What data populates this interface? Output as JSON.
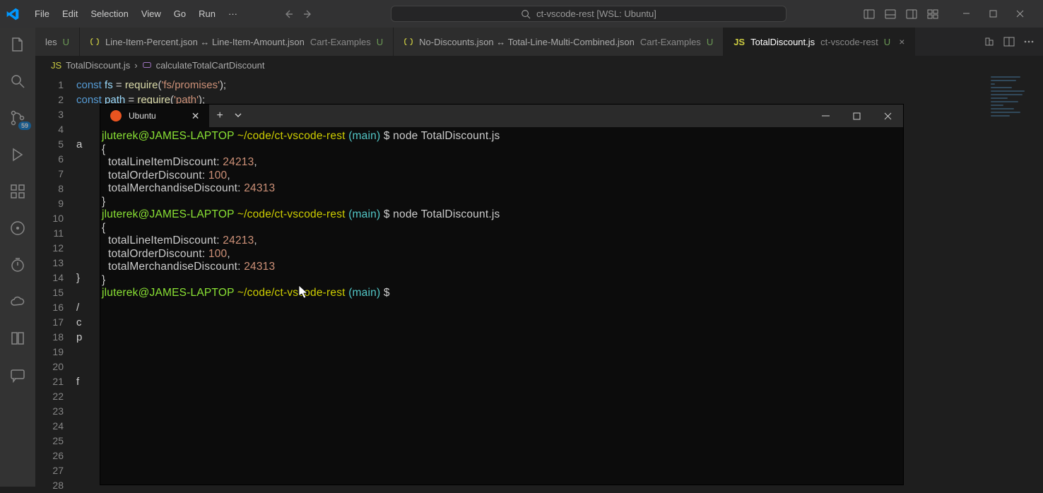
{
  "menu": {
    "file": "File",
    "edit": "Edit",
    "selection": "Selection",
    "view": "View",
    "go": "Go",
    "run": "Run",
    "more": "···"
  },
  "search_center": "ct-vscode-rest [WSL: Ubuntu]",
  "tabs": {
    "t0": {
      "label": "les",
      "mod": "U"
    },
    "t1": {
      "label": "Line-Item-Percent.json ↔ Line-Item-Amount.json",
      "context": "Cart-Examples",
      "mod": "U"
    },
    "t2": {
      "label": "No-Discounts.json ↔ Total-Line-Multi-Combined.json",
      "context": "Cart-Examples",
      "mod": "U"
    },
    "t3": {
      "label": "TotalDiscount.js",
      "context": "ct-vscode-rest",
      "mod": "U"
    }
  },
  "breadcrumb": {
    "file": "TotalDiscount.js",
    "symbol": "calculateTotalCartDiscount"
  },
  "code": {
    "l1": {
      "kw": "const",
      "var": "fs",
      "eq": "=",
      "fn": "require",
      "str": "'fs/promises'"
    },
    "l2": {
      "kw": "const",
      "var": "path",
      "eq": "=",
      "fn": "require",
      "str": "'path'"
    },
    "l5_char": "a",
    "l14_char": "}",
    "l16_char": "/",
    "l17_char": "c",
    "l18_char": "p",
    "l21_char": "f"
  },
  "scm_badge": "59",
  "terminal": {
    "tab": "Ubuntu",
    "user": "jluterek@JAMES-LAPTOP",
    "path": "~/code/ct-vscode-rest",
    "branch": "(main)",
    "cmd": "node TotalDiscount.js",
    "output": {
      "open": "{",
      "close": "}",
      "k1": "totalLineItemDiscount:",
      "v1": "24213",
      "k2": "totalOrderDiscount:",
      "v2": "100",
      "k3": "totalMerchandiseDiscount:",
      "v3": "24313"
    }
  }
}
